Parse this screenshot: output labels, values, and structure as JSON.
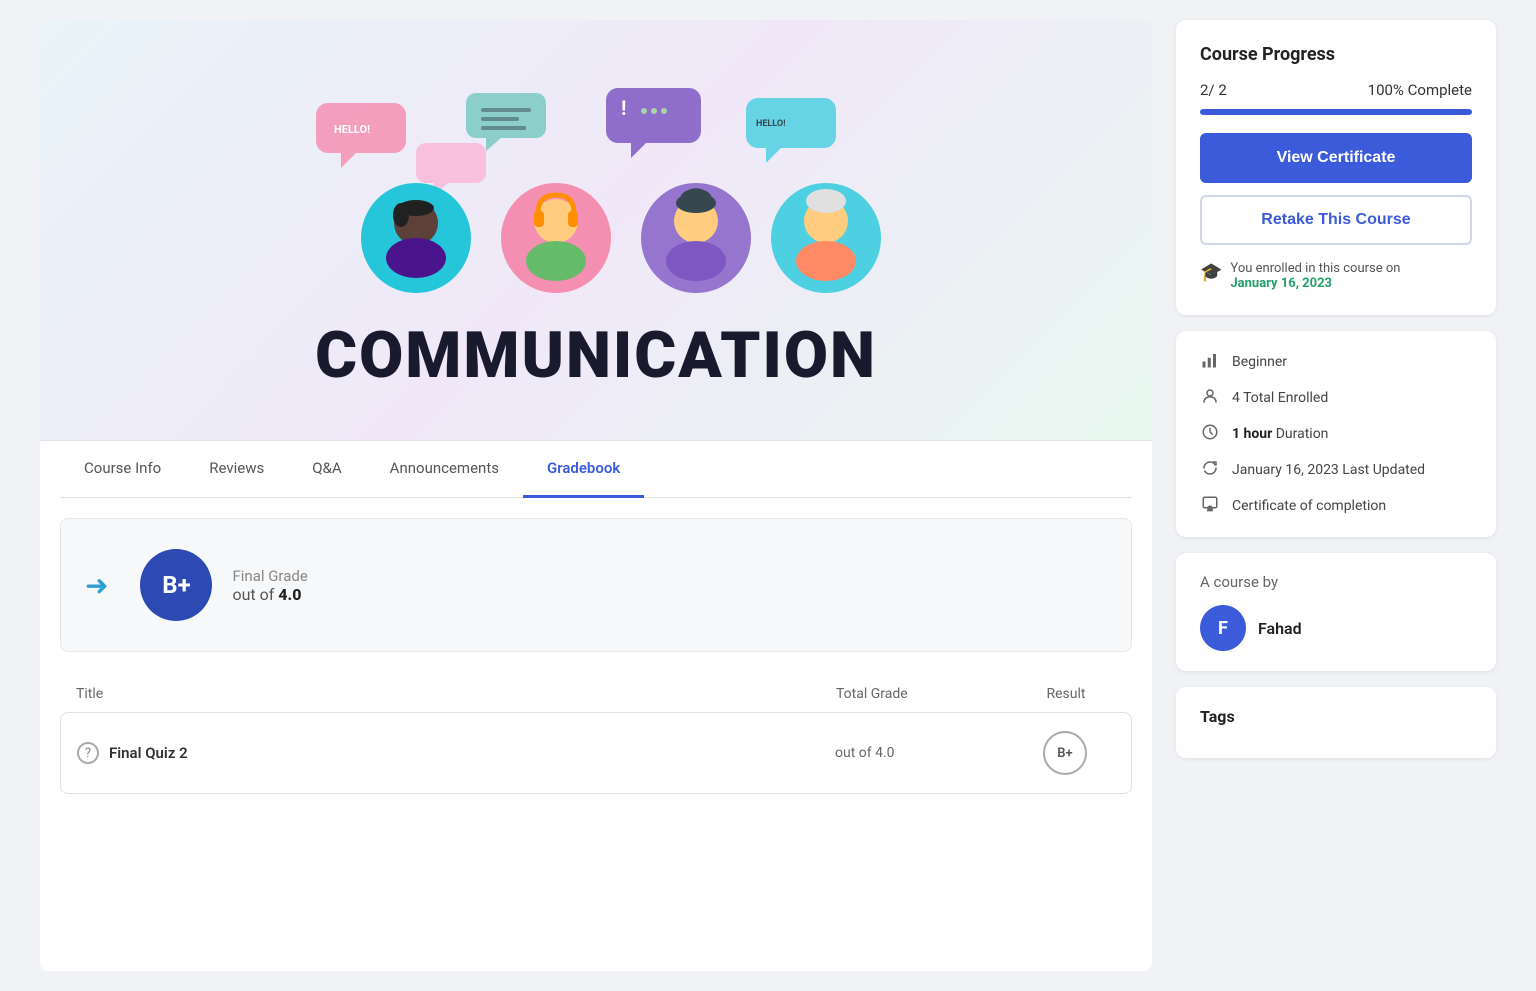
{
  "course": {
    "title": "COMMUNICATION",
    "banner_alt": "Communication course banner with people and speech bubbles"
  },
  "progress": {
    "current": "2/ 2",
    "percent_label": "100% Complete",
    "percent_value": 100
  },
  "buttons": {
    "view_certificate": "View Certificate",
    "retake_course": "Retake This Course"
  },
  "enrollment": {
    "notice": "You enrolled in this course on",
    "date": "January 16, 2023"
  },
  "meta": {
    "level": "Beginner",
    "enrolled": "4 Total Enrolled",
    "duration_value": "1 hour",
    "duration_label": "Duration",
    "last_updated_value": "January 16, 2023",
    "last_updated_label": "Last Updated",
    "certificate": "Certificate of completion"
  },
  "tabs": [
    {
      "id": "course-info",
      "label": "Course Info",
      "active": false
    },
    {
      "id": "reviews",
      "label": "Reviews",
      "active": false
    },
    {
      "id": "qna",
      "label": "Q&A",
      "active": false
    },
    {
      "id": "announcements",
      "label": "Announcements",
      "active": false
    },
    {
      "id": "gradebook",
      "label": "Gradebook",
      "active": true
    }
  ],
  "gradebook": {
    "grade_badge": "B+",
    "final_grade_label": "Final Grade",
    "out_of_text": "out of",
    "out_of_value": "4.0",
    "table_headers": {
      "title": "Title",
      "total_grade": "Total Grade",
      "result": "Result"
    },
    "quizzes": [
      {
        "name": "Final Quiz 2",
        "total_grade": "out of 4.0",
        "result": "B+"
      }
    ]
  },
  "course_by": {
    "label": "A course by",
    "instructor_initial": "F",
    "instructor_name": "Fahad"
  },
  "tags": {
    "label": "Tags"
  },
  "colors": {
    "primary": "#3b5bdb",
    "green": "#22a06b",
    "arrow": "#2d9fd3"
  }
}
